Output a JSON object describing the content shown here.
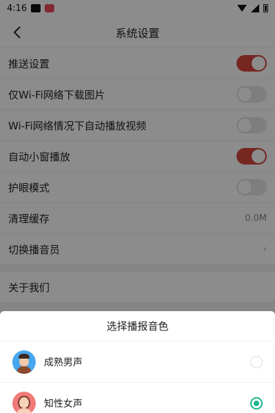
{
  "status_bar": {
    "time": "4:16"
  },
  "nav": {
    "title": "系统设置"
  },
  "settings": {
    "push": {
      "label": "推送设置",
      "enabled": true
    },
    "wifi_images": {
      "label": "仅Wi-Fi网络下载图片",
      "enabled": false
    },
    "wifi_autoplay": {
      "label": "Wi-Fi网络情况下自动播放视频",
      "enabled": false
    },
    "mini_window": {
      "label": "自动小窗播放",
      "enabled": true
    },
    "eye_mode": {
      "label": "护眼模式",
      "enabled": false
    },
    "clear_cache": {
      "label": "清理缓存",
      "value": "0.0M"
    },
    "switch_announcer": {
      "label": "切换播音员"
    },
    "about": {
      "label": "关于我们"
    }
  },
  "sheet": {
    "title": "选择播报音色",
    "options": [
      {
        "label": "成熟男声",
        "selected": false,
        "avatar": "male-avatar"
      },
      {
        "label": "知性女声",
        "selected": true,
        "avatar": "female-avatar"
      }
    ]
  },
  "colors": {
    "accent": "#d7463d",
    "radio_selected": "#19b58e"
  }
}
